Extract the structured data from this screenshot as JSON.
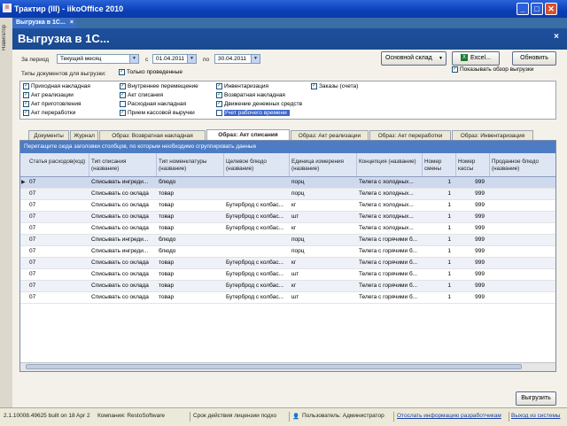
{
  "window": {
    "title": "Трактир (III) - iikoOffice 2010"
  },
  "left_strip": {
    "label": "Навигатор"
  },
  "doc_tab": {
    "label": "Выгрузка в 1С..."
  },
  "header": {
    "title": "Выгрузка в 1С..."
  },
  "filters": {
    "period_label": "За период",
    "period_value": "Текущий месяц",
    "from_label": "с",
    "from_value": "01.04.2011",
    "to_label": "по",
    "to_value": "30.04.2011",
    "store_value": "Основной склад",
    "doc_types_label": "Типы документов для выгрузки:",
    "only_processed_label": "Только проведенные",
    "show_preview_label": "Показывать обзор выгрузки"
  },
  "buttons": {
    "excel": "Excel...",
    "refresh": "Обновить",
    "upload": "Выгрузить"
  },
  "checkboxes": [
    [
      {
        "label": "Приходная накладная",
        "checked": true
      },
      {
        "label": "Акт реализации",
        "checked": true
      },
      {
        "label": "Акт приготовления",
        "checked": true
      },
      {
        "label": "Акт переработки",
        "checked": true
      }
    ],
    [
      {
        "label": "Внутреннее перемещение",
        "checked": true
      },
      {
        "label": "Акт списания",
        "checked": true
      },
      {
        "label": "Расходная накладная",
        "checked": false
      },
      {
        "label": "Прием кассовой выручки",
        "checked": true
      }
    ],
    [
      {
        "label": "Инвентаризация",
        "checked": true
      },
      {
        "label": "Возвратная накладная",
        "checked": true
      },
      {
        "label": "Движение денежных средств",
        "checked": true
      },
      {
        "label": "Учет рабочего времени",
        "checked": false
      }
    ],
    [
      {
        "label": "Заказы (счета)",
        "checked": true
      }
    ]
  ],
  "tabs": [
    "Документы",
    "Журнал",
    "Образ: Возвратная накладная",
    "Образ: Акт списания",
    "Образ: Акт реализации",
    "Образ: Акт переработки",
    "Образ: Инвентаризация"
  ],
  "active_tab": 3,
  "grid": {
    "group_hint": "Перетащите сюда заголовки столбцов, по которым необходимо сгруппировать данные",
    "columns": [
      "Статья расходов(код)",
      "Тип списания (название)",
      "Тип номенклатуры (название)",
      "Целевое блюдо (название)",
      "Единица измерения (название)",
      "Концепция (название)",
      "Номер смены",
      "Номер кассы",
      "Проданное блюдо (название)"
    ],
    "rows": [
      [
        "07",
        "Списывать ингреди...",
        "блюдо",
        "",
        "порц",
        "Телега с холодных...",
        "1",
        "999",
        ""
      ],
      [
        "07",
        "Списывать со оклада",
        "товар",
        "",
        "порц",
        "Телега с холодных...",
        "1",
        "999",
        ""
      ],
      [
        "07",
        "Списывать со оклада",
        "товар",
        "Бутерброд с колбас...",
        "кг",
        "Телега с холодных...",
        "1",
        "999",
        ""
      ],
      [
        "07",
        "Списывать со оклада",
        "товар",
        "Бутерброд с колбас...",
        "шт",
        "Телега с холодных...",
        "1",
        "999",
        ""
      ],
      [
        "07",
        "Списывать со оклада",
        "товар",
        "Бутерброд с колбас...",
        "кг",
        "Телега с холодных...",
        "1",
        "999",
        ""
      ],
      [
        "07",
        "Списывать ингреди...",
        "блюдо",
        "",
        "порц",
        "Телега с горячими б...",
        "1",
        "999",
        ""
      ],
      [
        "07",
        "Списывать ингреди...",
        "блюдо",
        "",
        "порц",
        "Телега с горячими б...",
        "1",
        "999",
        ""
      ],
      [
        "07",
        "Списывать со оклада",
        "товар",
        "Бутерброд с колбас...",
        "кг",
        "Телега с горячими б...",
        "1",
        "999",
        ""
      ],
      [
        "07",
        "Списывать со оклада",
        "товар",
        "Бутерброд с колбас...",
        "шт",
        "Телега с горячими б...",
        "1",
        "999",
        ""
      ],
      [
        "07",
        "Списывать со оклада",
        "товар",
        "Бутерброд с колбас...",
        "кг",
        "Телега с горячими б...",
        "1",
        "999",
        ""
      ],
      [
        "07",
        "Списывать со оклада",
        "товар",
        "Бутерброд с колбас...",
        "шт",
        "Телега с горячими б...",
        "1",
        "999",
        ""
      ]
    ]
  },
  "statusbar": {
    "version": "2.1.10008.49625 built on 18 Apr 2",
    "company": "Компания: RestoSoftware",
    "license": "Срок действия лицензии подхо",
    "user": "Пользователь: Администратор",
    "report_link": "Отослать информацию разработчикам",
    "exit_link": "Выход из системы"
  }
}
